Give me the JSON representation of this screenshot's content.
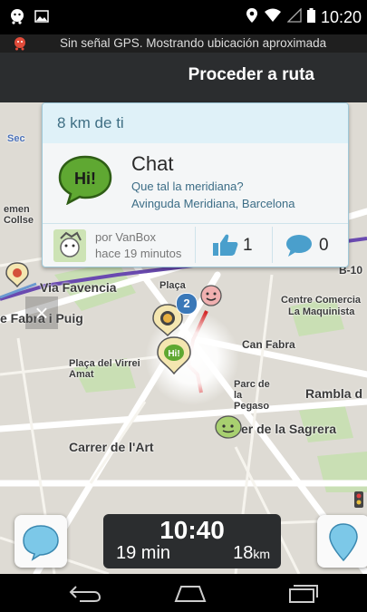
{
  "status_bar": {
    "time": "10:20"
  },
  "gps_banner": {
    "text": "Sin señal GPS. Mostrando ubicación aproximada"
  },
  "top_bar": {
    "title": "Proceder a ruta"
  },
  "card": {
    "distance": "8 km de ti",
    "title": "Chat",
    "message": "Que tal la meridiana?",
    "address": "Avinguda Meridiana, Barcelona",
    "author": "por VanBox",
    "time_ago": "hace 19 minutos",
    "thumbs_count": "1",
    "comments_count": "0",
    "hi_icon_text": "Hi!"
  },
  "map": {
    "labels": [
      "Sec",
      "emen",
      "Collse",
      "B-10",
      "Via Favencia",
      "e Fabra i Puig",
      "Plaça",
      "Plaça del Virrei Amat",
      "Can Fabra",
      "Parc de la Pegaso",
      "Rambla d",
      "er de la Sagrera",
      "Carrer de l'Art",
      "Centre Comercia",
      "La Maquinista"
    ],
    "close_label": "×"
  },
  "eta": {
    "arrival": "10:40",
    "duration": "19 min",
    "distance_value": "18",
    "distance_unit": "km"
  },
  "colors": {
    "accent": "#42a5cf",
    "route": "#d42a2a",
    "panel": "#2b2d2f"
  }
}
